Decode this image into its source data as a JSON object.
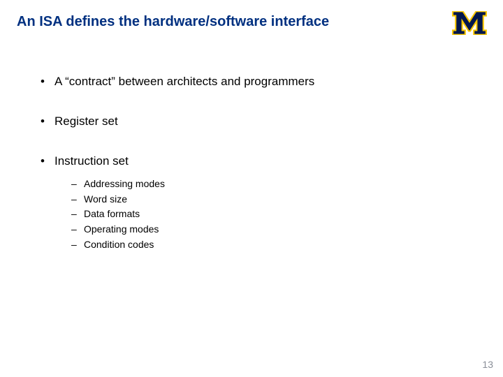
{
  "title": "An ISA defines the hardware/software interface",
  "bullets": {
    "b0": "A “contract” between architects and programmers",
    "b1": "Register set",
    "b2": "Instruction set"
  },
  "sub": {
    "s0": "Addressing modes",
    "s1": "Word size",
    "s2": "Data formats",
    "s3": "Operating modes",
    "s4": "Condition codes"
  },
  "page": "13",
  "logo_name": "michigan-m-logo"
}
